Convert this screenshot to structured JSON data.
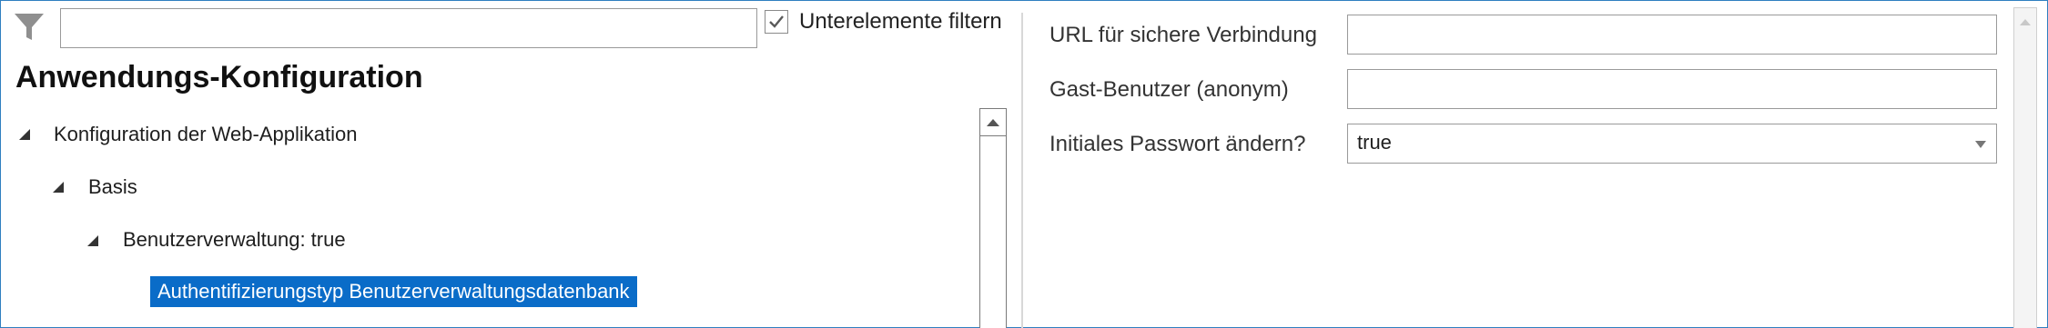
{
  "filter": {
    "icon": "filter-icon",
    "placeholder": "",
    "value": "",
    "subitems_checkbox": {
      "label": "Unterelemente filtern",
      "checked": true
    }
  },
  "title": "Anwendungs-Konfiguration",
  "tree": {
    "items": [
      {
        "label": "Konfiguration der Web-Applikation",
        "level": 0,
        "expanded": true
      },
      {
        "label": "Basis",
        "level": 1,
        "expanded": true
      },
      {
        "label": "Benutzerverwaltung: true",
        "level": 2,
        "expanded": true
      },
      {
        "label": "Authentifizierungstyp Benutzerverwaltungsdatenbank",
        "level": 3,
        "selected": true
      }
    ]
  },
  "properties": [
    {
      "label": "URL für sichere Verbindung",
      "value": ""
    },
    {
      "label": "Gast-Benutzer (anonym)",
      "value": ""
    },
    {
      "label": "Initiales Passwort ändern?",
      "value": "true",
      "type": "dropdown"
    }
  ],
  "colors": {
    "selection": "#0a6cc8",
    "frame_border": "#2f7fc0"
  }
}
